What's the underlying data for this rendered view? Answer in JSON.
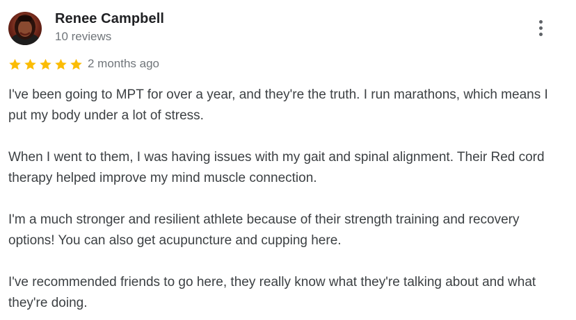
{
  "review": {
    "author_name": "Renee Campbell",
    "author_reviews": "10 reviews",
    "rating": 5,
    "rating_max": 5,
    "star_color": "#fbbc04",
    "date": "2 months ago",
    "more_icon": "more-vert-icon",
    "paragraphs": [
      "I've been going to MPT for over a year, and they're the truth. I run marathons, which means I put my body under a lot of stress.",
      "When I went to them, I was having issues with my gait and spinal alignment. Their Red cord therapy helped improve my mind muscle connection.",
      "I'm a much stronger and resilient athlete because of their strength training and recovery options! You can also get acupuncture and cupping here.",
      "I've recommended friends to go here, they really know what they're talking about and what they're doing."
    ]
  }
}
